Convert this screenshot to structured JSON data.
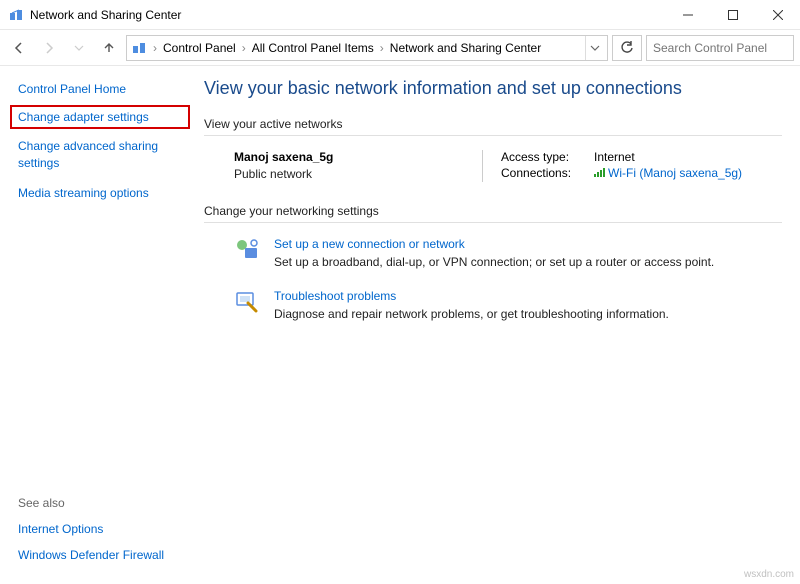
{
  "window": {
    "title": "Network and Sharing Center"
  },
  "breadcrumb": {
    "items": [
      "Control Panel",
      "All Control Panel Items",
      "Network and Sharing Center"
    ]
  },
  "search": {
    "placeholder": "Search Control Panel"
  },
  "sidebar": {
    "home": "Control Panel Home",
    "links": [
      "Change adapter settings",
      "Change advanced sharing settings",
      "Media streaming options"
    ],
    "seealso_label": "See also",
    "seealso": [
      "Internet Options",
      "Windows Defender Firewall"
    ]
  },
  "content": {
    "page_title": "View your basic network information and set up connections",
    "active_networks_label": "View your active networks",
    "network": {
      "name": "Manoj saxena_5g",
      "type": "Public network",
      "access_type_label": "Access type:",
      "access_type_value": "Internet",
      "connections_label": "Connections:",
      "connection_name": "Wi-Fi (Manoj saxena_5g)"
    },
    "change_settings_label": "Change your networking settings",
    "setup": {
      "title": "Set up a new connection or network",
      "desc": "Set up a broadband, dial-up, or VPN connection; or set up a router or access point."
    },
    "troubleshoot": {
      "title": "Troubleshoot problems",
      "desc": "Diagnose and repair network problems, or get troubleshooting information."
    }
  },
  "watermark": "wsxdn.com"
}
